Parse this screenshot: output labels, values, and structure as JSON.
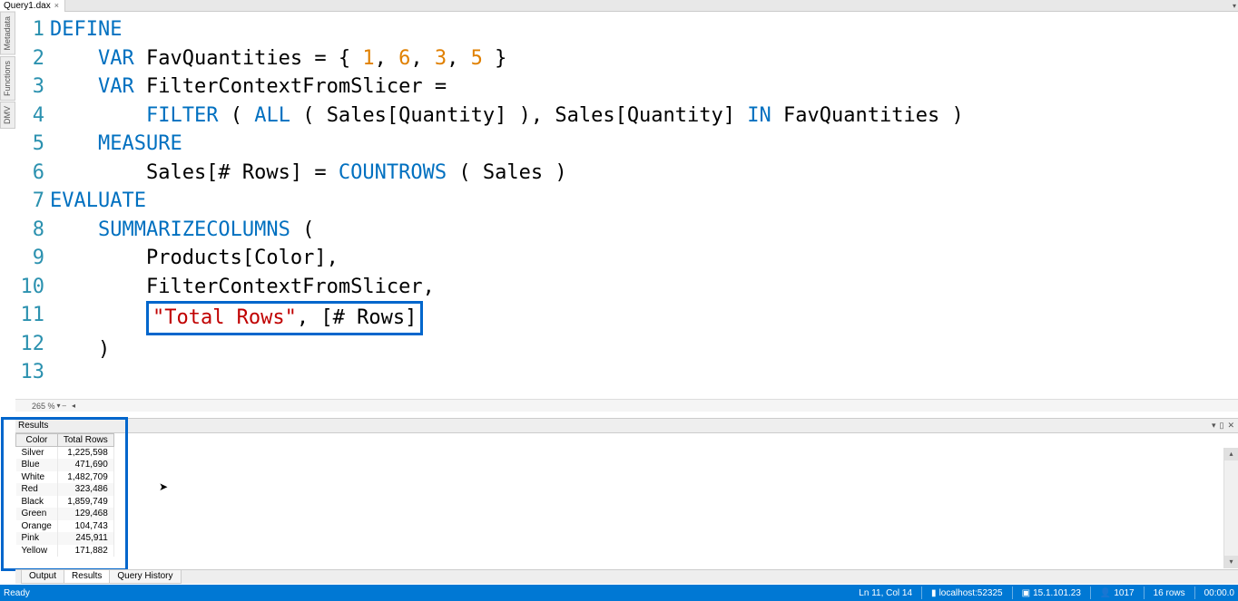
{
  "tab": {
    "title": "Query1.dax"
  },
  "side_tabs": [
    "Metadata",
    "Functions",
    "DMV"
  ],
  "editor": {
    "lines": [
      {
        "n": 1,
        "tokens": [
          {
            "t": "DEFINE",
            "c": "kw"
          }
        ]
      },
      {
        "n": 2,
        "tokens": [
          {
            "t": "    ",
            "c": "txt"
          },
          {
            "t": "VAR",
            "c": "kw"
          },
          {
            "t": " FavQuantities = { ",
            "c": "txt"
          },
          {
            "t": "1",
            "c": "num"
          },
          {
            "t": ", ",
            "c": "txt"
          },
          {
            "t": "6",
            "c": "num"
          },
          {
            "t": ", ",
            "c": "txt"
          },
          {
            "t": "3",
            "c": "num"
          },
          {
            "t": ", ",
            "c": "txt"
          },
          {
            "t": "5",
            "c": "num"
          },
          {
            "t": " }",
            "c": "txt"
          }
        ]
      },
      {
        "n": 3,
        "tokens": [
          {
            "t": "    ",
            "c": "txt"
          },
          {
            "t": "VAR",
            "c": "kw"
          },
          {
            "t": " FilterContextFromSlicer =",
            "c": "txt"
          }
        ]
      },
      {
        "n": 4,
        "tokens": [
          {
            "t": "        ",
            "c": "txt"
          },
          {
            "t": "FILTER",
            "c": "fn"
          },
          {
            "t": " ( ",
            "c": "txt"
          },
          {
            "t": "ALL",
            "c": "fn"
          },
          {
            "t": " ( Sales[Quantity] ), Sales[Quantity] ",
            "c": "txt"
          },
          {
            "t": "IN",
            "c": "kw"
          },
          {
            "t": " FavQuantities )",
            "c": "txt"
          }
        ]
      },
      {
        "n": 5,
        "tokens": [
          {
            "t": "    ",
            "c": "txt"
          },
          {
            "t": "MEASURE",
            "c": "kw"
          }
        ]
      },
      {
        "n": 6,
        "tokens": [
          {
            "t": "        Sales[# Rows] = ",
            "c": "txt"
          },
          {
            "t": "COUNTROWS",
            "c": "fn"
          },
          {
            "t": " ( Sales )",
            "c": "txt"
          }
        ]
      },
      {
        "n": 7,
        "tokens": [
          {
            "t": "EVALUATE",
            "c": "kw"
          }
        ]
      },
      {
        "n": 8,
        "tokens": [
          {
            "t": "    ",
            "c": "txt"
          },
          {
            "t": "SUMMARIZECOLUMNS",
            "c": "fn"
          },
          {
            "t": " (",
            "c": "txt"
          }
        ]
      },
      {
        "n": 9,
        "tokens": [
          {
            "t": "        Products[Color],",
            "c": "txt"
          }
        ]
      },
      {
        "n": 10,
        "tokens": [
          {
            "t": "        FilterContextFromSlicer,",
            "c": "txt"
          }
        ]
      },
      {
        "n": 11,
        "tokens": [
          {
            "t": "        ",
            "c": "txt"
          }
        ],
        "box": [
          {
            "t": "\"Total Rows\"",
            "c": "str"
          },
          {
            "t": ", [# Rows]",
            "c": "txt"
          }
        ]
      },
      {
        "n": 12,
        "tokens": [
          {
            "t": "    )",
            "c": "txt"
          }
        ]
      },
      {
        "n": 13,
        "tokens": []
      }
    ]
  },
  "zoom": {
    "level": "265 %"
  },
  "results": {
    "title": "Results",
    "columns": [
      "Color",
      "Total Rows"
    ],
    "rows": [
      [
        "Silver",
        "1,225,598"
      ],
      [
        "Blue",
        "471,690"
      ],
      [
        "White",
        "1,482,709"
      ],
      [
        "Red",
        "323,486"
      ],
      [
        "Black",
        "1,859,749"
      ],
      [
        "Green",
        "129,468"
      ],
      [
        "Orange",
        "104,743"
      ],
      [
        "Pink",
        "245,911"
      ],
      [
        "Yellow",
        "171,882"
      ]
    ]
  },
  "bottom_tabs": {
    "output": "Output",
    "results": "Results",
    "history": "Query History"
  },
  "status": {
    "ready": "Ready",
    "pos": "Ln 11, Col 14",
    "host": "localhost:52325",
    "version": "15.1.101.23",
    "users": "1017",
    "rows": "16 rows",
    "time": "00:00.0"
  }
}
